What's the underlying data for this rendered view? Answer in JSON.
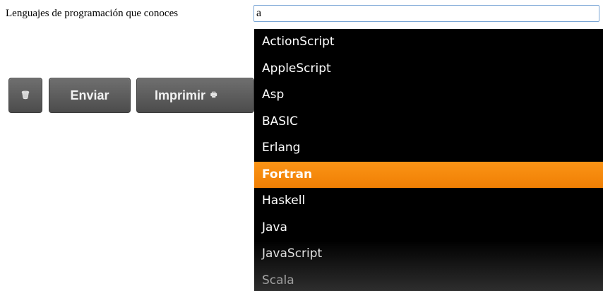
{
  "form": {
    "label": "Lenguajes de programación que conoces",
    "input_value": "a"
  },
  "buttons": {
    "clear_icon": "trash-icon",
    "clear_glyph": "🗑",
    "send_label": "Enviar",
    "print_label": "Imprimir",
    "print_icon": "print-icon",
    "print_glyph": "🖶"
  },
  "autocomplete": {
    "items": [
      {
        "label": "ActionScript"
      },
      {
        "label": "AppleScript"
      },
      {
        "label": "Asp"
      },
      {
        "label": "BASIC"
      },
      {
        "label": "Erlang"
      },
      {
        "label": "Fortran"
      },
      {
        "label": "Haskell"
      },
      {
        "label": "Java"
      },
      {
        "label": "JavaScript"
      },
      {
        "label": "Scala"
      }
    ],
    "highlighted": "Fortran"
  },
  "colors": {
    "dropdown_bg": "#000000",
    "highlight": "#f7890c",
    "button_bg": "#5c5c5c"
  }
}
